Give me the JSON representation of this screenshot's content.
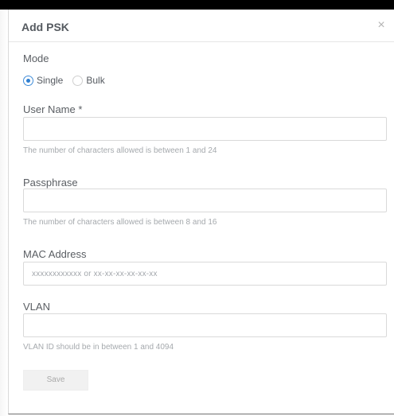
{
  "dialog": {
    "title": "Add PSK",
    "close_glyph": "×",
    "close_icon": "close-icon"
  },
  "mode": {
    "label": "Mode",
    "options": [
      {
        "label": "Single",
        "selected": true
      },
      {
        "label": "Bulk",
        "selected": false
      }
    ]
  },
  "fields": {
    "user_name": {
      "label": "User Name *",
      "value": "",
      "placeholder": "",
      "help": "The number of characters allowed is between 1 and 24"
    },
    "passphrase": {
      "label": "Passphrase",
      "value": "",
      "placeholder": "",
      "help": "The number of characters allowed is between 8 and 16"
    },
    "mac_address": {
      "label": "MAC Address",
      "value": "",
      "placeholder": "xxxxxxxxxxxx or xx-xx-xx-xx-xx-xx"
    },
    "vlan": {
      "label": "VLAN",
      "value": "",
      "placeholder": "",
      "help": "VLAN ID should be in between 1 and 4094"
    }
  },
  "actions": {
    "save_label": "Save"
  },
  "colors": {
    "accent": "#2f7fd1",
    "border": "#d9d9d9",
    "help_text": "#a5a9ad"
  }
}
